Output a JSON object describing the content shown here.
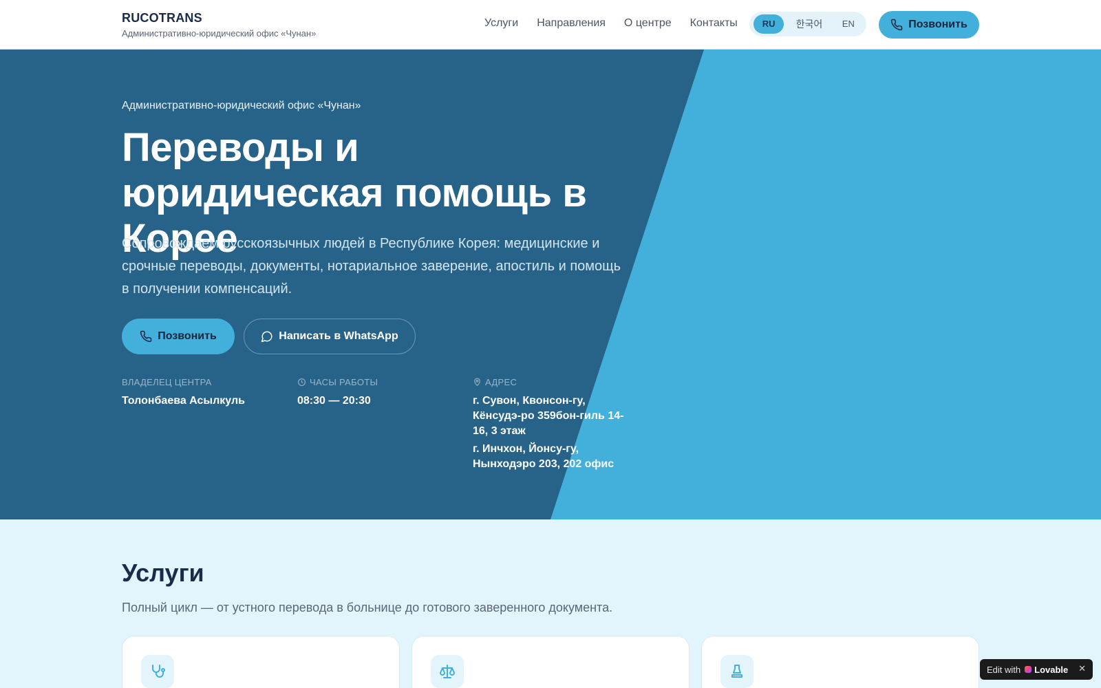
{
  "brand": {
    "name": "RUCOTRANS",
    "subtitle": "Административно-юридический офис «Чунан»"
  },
  "nav": {
    "items": [
      "Услуги",
      "Направления",
      "О центре",
      "Контакты"
    ]
  },
  "lang": {
    "options": [
      "RU",
      "한국어",
      "EN"
    ],
    "selected": "RU"
  },
  "header_call": "Позвонить",
  "hero": {
    "kicker": "Административно-юридический офис «Чунан»",
    "title": "Переводы и юридическая помощь в Корее",
    "description": "Сопровождаем русскоязычных людей в Республике Корея: медицинские и срочные переводы, документы, нотариальное заверение, апостиль и помощь в получении компенсаций.",
    "btn_call": "Позвонить",
    "btn_whatsapp": "Написать в WhatsApp",
    "owner_label": "Владелец центра",
    "owner_value": "Толонбаева Асылкуль",
    "hours_label": "Часы работы",
    "hours_value": "08:30 — 20:30",
    "address_label": "Адрес",
    "address_1": "г. Сувон, Квонсон-гу, Кёнсудэ-ро 359бон-гиль 14-16, 3 этаж",
    "address_2": "г. Инчхон, Йонсу-гу, Нынходэро 203, 202 офис"
  },
  "services": {
    "title": "Услуги",
    "subtitle": "Полный цикл — от устного перевода в больнице до готового заверенного документа."
  },
  "badge": {
    "prefix": "Edit with",
    "brand": "Lovable",
    "close": "✕"
  },
  "colors": {
    "dark_blue": "#276388",
    "accent": "#43afdb",
    "page_bg": "#e2f5fc"
  }
}
